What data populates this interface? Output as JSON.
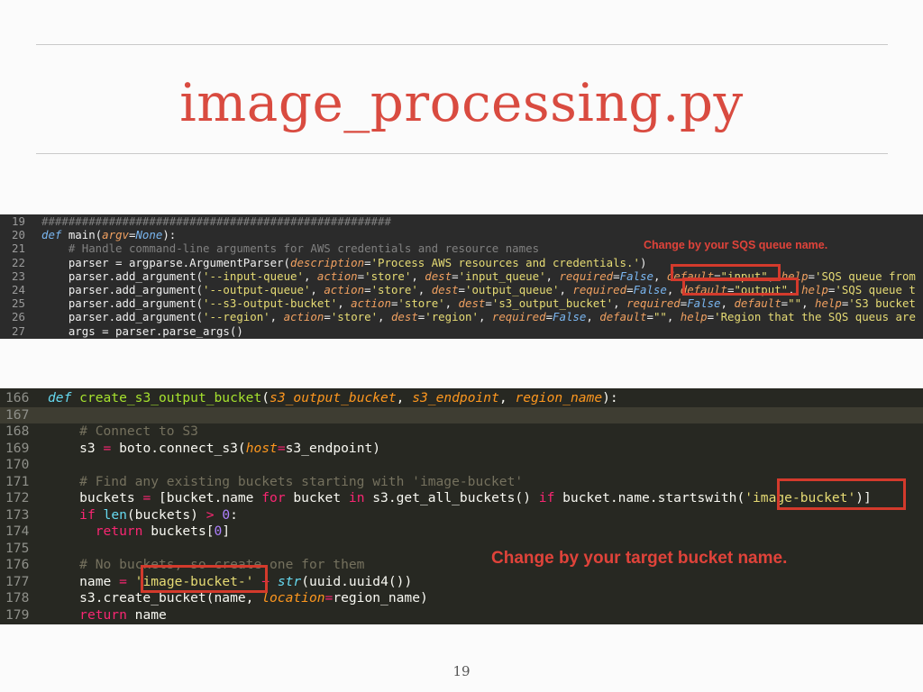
{
  "slide": {
    "title": "image_processing.py",
    "page_number": "19"
  },
  "snippet1": {
    "lines": [
      {
        "n": "19",
        "tokens": [
          {
            "c": "t-cmt1",
            "t": "####################################################"
          }
        ]
      },
      {
        "n": "20",
        "tokens": [
          {
            "c": "t-kw1",
            "t": "def"
          },
          {
            "c": "t-plain1",
            "t": " main("
          },
          {
            "c": "t-arg1",
            "t": "argv"
          },
          {
            "c": "t-plain1",
            "t": "="
          },
          {
            "c": "t-kw1",
            "t": "None"
          },
          {
            "c": "t-plain1",
            "t": "):"
          }
        ]
      },
      {
        "n": "21",
        "tokens": [
          {
            "c": "t-cmt1",
            "t": "    # Handle command-line arguments for AWS credentials and resource names"
          }
        ]
      },
      {
        "n": "22",
        "tokens": [
          {
            "c": "t-plain1",
            "t": "    parser = argparse.ArgumentParser("
          },
          {
            "c": "t-arg1",
            "t": "description"
          },
          {
            "c": "t-plain1",
            "t": "="
          },
          {
            "c": "t-str1",
            "t": "'Process AWS resources and credentials.'"
          },
          {
            "c": "t-plain1",
            "t": ")"
          }
        ]
      },
      {
        "n": "23",
        "tokens": [
          {
            "c": "t-plain1",
            "t": "    parser.add_argument("
          },
          {
            "c": "t-str1",
            "t": "'--input-queue'"
          },
          {
            "c": "t-plain1",
            "t": ", "
          },
          {
            "c": "t-arg1",
            "t": "action"
          },
          {
            "c": "t-plain1",
            "t": "="
          },
          {
            "c": "t-str1",
            "t": "'store'"
          },
          {
            "c": "t-plain1",
            "t": ", "
          },
          {
            "c": "t-arg1",
            "t": "dest"
          },
          {
            "c": "t-plain1",
            "t": "="
          },
          {
            "c": "t-str1",
            "t": "'input_queue'"
          },
          {
            "c": "t-plain1",
            "t": ", "
          },
          {
            "c": "t-arg1",
            "t": "required"
          },
          {
            "c": "t-plain1",
            "t": "="
          },
          {
            "c": "t-kw1",
            "t": "False"
          },
          {
            "c": "t-plain1",
            "t": ", "
          },
          {
            "c": "t-arg1",
            "t": "default"
          },
          {
            "c": "t-plain1",
            "t": "="
          },
          {
            "c": "t-str1",
            "t": "\"input\""
          },
          {
            "c": "t-plain1",
            "t": ", "
          },
          {
            "c": "t-arg1",
            "t": "help"
          },
          {
            "c": "t-plain1",
            "t": "="
          },
          {
            "c": "t-str1",
            "t": "'SQS queue from"
          }
        ]
      },
      {
        "n": "24",
        "tokens": [
          {
            "c": "t-plain1",
            "t": "    parser.add_argument("
          },
          {
            "c": "t-str1",
            "t": "'--output-queue'"
          },
          {
            "c": "t-plain1",
            "t": ", "
          },
          {
            "c": "t-arg1",
            "t": "action"
          },
          {
            "c": "t-plain1",
            "t": "="
          },
          {
            "c": "t-str1",
            "t": "'store'"
          },
          {
            "c": "t-plain1",
            "t": ", "
          },
          {
            "c": "t-arg1",
            "t": "dest"
          },
          {
            "c": "t-plain1",
            "t": "="
          },
          {
            "c": "t-str1",
            "t": "'output_queue'"
          },
          {
            "c": "t-plain1",
            "t": ", "
          },
          {
            "c": "t-arg1",
            "t": "required"
          },
          {
            "c": "t-plain1",
            "t": "="
          },
          {
            "c": "t-kw1",
            "t": "False"
          },
          {
            "c": "t-plain1",
            "t": ", "
          },
          {
            "c": "t-arg1",
            "t": "default"
          },
          {
            "c": "t-plain1",
            "t": "="
          },
          {
            "c": "t-str1",
            "t": "\"output\""
          },
          {
            "c": "t-plain1",
            "t": ", "
          },
          {
            "c": "t-arg1",
            "t": "help"
          },
          {
            "c": "t-plain1",
            "t": "="
          },
          {
            "c": "t-str1",
            "t": "'SQS queue t"
          }
        ]
      },
      {
        "n": "25",
        "tokens": [
          {
            "c": "t-plain1",
            "t": "    parser.add_argument("
          },
          {
            "c": "t-str1",
            "t": "'--s3-output-bucket'"
          },
          {
            "c": "t-plain1",
            "t": ", "
          },
          {
            "c": "t-arg1",
            "t": "action"
          },
          {
            "c": "t-plain1",
            "t": "="
          },
          {
            "c": "t-str1",
            "t": "'store'"
          },
          {
            "c": "t-plain1",
            "t": ", "
          },
          {
            "c": "t-arg1",
            "t": "dest"
          },
          {
            "c": "t-plain1",
            "t": "="
          },
          {
            "c": "t-str1",
            "t": "'s3_output_bucket'"
          },
          {
            "c": "t-plain1",
            "t": ", "
          },
          {
            "c": "t-arg1",
            "t": "required"
          },
          {
            "c": "t-plain1",
            "t": "="
          },
          {
            "c": "t-kw1",
            "t": "False"
          },
          {
            "c": "t-plain1",
            "t": ", "
          },
          {
            "c": "t-arg1",
            "t": "default"
          },
          {
            "c": "t-plain1",
            "t": "="
          },
          {
            "c": "t-str1",
            "t": "\"\""
          },
          {
            "c": "t-plain1",
            "t": ", "
          },
          {
            "c": "t-arg1",
            "t": "help"
          },
          {
            "c": "t-plain1",
            "t": "="
          },
          {
            "c": "t-str1",
            "t": "'S3 bucket"
          }
        ]
      },
      {
        "n": "26",
        "tokens": [
          {
            "c": "t-plain1",
            "t": "    parser.add_argument("
          },
          {
            "c": "t-str1",
            "t": "'--region'"
          },
          {
            "c": "t-plain1",
            "t": ", "
          },
          {
            "c": "t-arg1",
            "t": "action"
          },
          {
            "c": "t-plain1",
            "t": "="
          },
          {
            "c": "t-str1",
            "t": "'store'"
          },
          {
            "c": "t-plain1",
            "t": ", "
          },
          {
            "c": "t-arg1",
            "t": "dest"
          },
          {
            "c": "t-plain1",
            "t": "="
          },
          {
            "c": "t-str1",
            "t": "'region'"
          },
          {
            "c": "t-plain1",
            "t": ", "
          },
          {
            "c": "t-arg1",
            "t": "required"
          },
          {
            "c": "t-plain1",
            "t": "="
          },
          {
            "c": "t-kw1",
            "t": "False"
          },
          {
            "c": "t-plain1",
            "t": ", "
          },
          {
            "c": "t-arg1",
            "t": "default"
          },
          {
            "c": "t-plain1",
            "t": "="
          },
          {
            "c": "t-str1",
            "t": "\"\""
          },
          {
            "c": "t-plain1",
            "t": ", "
          },
          {
            "c": "t-arg1",
            "t": "help"
          },
          {
            "c": "t-plain1",
            "t": "="
          },
          {
            "c": "t-str1",
            "t": "'Region that the SQS queus are"
          }
        ]
      },
      {
        "n": "27",
        "tokens": [
          {
            "c": "t-plain1",
            "t": "    args = parser.parse_args()"
          }
        ]
      }
    ],
    "annotation": "Change by your SQS queue name."
  },
  "snippet2": {
    "lines": [
      {
        "n": "166",
        "tokens": [
          {
            "c": "t-def",
            "t": "def"
          },
          {
            "c": "t-plain",
            "t": " "
          },
          {
            "c": "t-fn",
            "t": "create_s3_output_bucket"
          },
          {
            "c": "t-plain",
            "t": "("
          },
          {
            "c": "t-arg",
            "t": "s3_output_bucket"
          },
          {
            "c": "t-plain",
            "t": ", "
          },
          {
            "c": "t-arg",
            "t": "s3_endpoint"
          },
          {
            "c": "t-plain",
            "t": ", "
          },
          {
            "c": "t-arg",
            "t": "region_name"
          },
          {
            "c": "t-plain",
            "t": "):"
          }
        ]
      },
      {
        "n": "167",
        "cur": true,
        "tokens": [
          {
            "c": "t-plain",
            "t": ""
          }
        ]
      },
      {
        "n": "168",
        "tokens": [
          {
            "c": "t-cmt",
            "t": "    # Connect to S3"
          }
        ]
      },
      {
        "n": "169",
        "tokens": [
          {
            "c": "t-plain",
            "t": "    s3 "
          },
          {
            "c": "t-key",
            "t": "="
          },
          {
            "c": "t-plain",
            "t": " boto.connect_s3("
          },
          {
            "c": "t-arg",
            "t": "host"
          },
          {
            "c": "t-key",
            "t": "="
          },
          {
            "c": "t-plain",
            "t": "s3_endpoint)"
          }
        ]
      },
      {
        "n": "170",
        "tokens": [
          {
            "c": "t-plain",
            "t": ""
          }
        ]
      },
      {
        "n": "171",
        "tokens": [
          {
            "c": "t-cmt",
            "t": "    # Find any existing buckets starting with 'image-bucket'"
          }
        ]
      },
      {
        "n": "172",
        "tokens": [
          {
            "c": "t-plain",
            "t": "    buckets "
          },
          {
            "c": "t-key",
            "t": "="
          },
          {
            "c": "t-plain",
            "t": " [bucket.name "
          },
          {
            "c": "t-key",
            "t": "for"
          },
          {
            "c": "t-plain",
            "t": " bucket "
          },
          {
            "c": "t-key",
            "t": "in"
          },
          {
            "c": "t-plain",
            "t": " s3.get_all_buckets() "
          },
          {
            "c": "t-key",
            "t": "if"
          },
          {
            "c": "t-plain",
            "t": " bucket.name.startswith("
          },
          {
            "c": "t-str",
            "t": "'image-bucket'"
          },
          {
            "c": "t-plain",
            "t": ")]"
          }
        ]
      },
      {
        "n": "173",
        "tokens": [
          {
            "c": "t-plain",
            "t": "    "
          },
          {
            "c": "t-key",
            "t": "if"
          },
          {
            "c": "t-plain",
            "t": " "
          },
          {
            "c": "t-bi",
            "t": "len"
          },
          {
            "c": "t-plain",
            "t": "(buckets) "
          },
          {
            "c": "t-key",
            "t": ">"
          },
          {
            "c": "t-plain",
            "t": " "
          },
          {
            "c": "t-num",
            "t": "0"
          },
          {
            "c": "t-plain",
            "t": ":"
          }
        ]
      },
      {
        "n": "174",
        "tokens": [
          {
            "c": "t-plain",
            "t": "      "
          },
          {
            "c": "t-key",
            "t": "return"
          },
          {
            "c": "t-plain",
            "t": " buckets["
          },
          {
            "c": "t-num",
            "t": "0"
          },
          {
            "c": "t-plain",
            "t": "]"
          }
        ]
      },
      {
        "n": "175",
        "tokens": [
          {
            "c": "t-plain",
            "t": ""
          }
        ]
      },
      {
        "n": "176",
        "tokens": [
          {
            "c": "t-cmt",
            "t": "    # No buckets, so create one for them"
          }
        ]
      },
      {
        "n": "177",
        "tokens": [
          {
            "c": "t-plain",
            "t": "    name "
          },
          {
            "c": "t-key",
            "t": "="
          },
          {
            "c": "t-plain",
            "t": " "
          },
          {
            "c": "t-str",
            "t": "'image-bucket-'"
          },
          {
            "c": "t-plain",
            "t": " "
          },
          {
            "c": "t-key",
            "t": "+"
          },
          {
            "c": "t-plain",
            "t": " "
          },
          {
            "c": "t-def",
            "t": "str"
          },
          {
            "c": "t-plain",
            "t": "(uuid.uuid4())"
          }
        ]
      },
      {
        "n": "178",
        "tokens": [
          {
            "c": "t-plain",
            "t": "    s3.create_bucket(name, "
          },
          {
            "c": "t-arg",
            "t": "location"
          },
          {
            "c": "t-key",
            "t": "="
          },
          {
            "c": "t-plain",
            "t": "region_name)"
          }
        ]
      },
      {
        "n": "179",
        "tokens": [
          {
            "c": "t-plain",
            "t": "    "
          },
          {
            "c": "t-key",
            "t": "return"
          },
          {
            "c": "t-plain",
            "t": " name"
          }
        ]
      }
    ],
    "annotation": "Change by your target bucket name."
  },
  "colors": {
    "title": "#d94b40",
    "highlight_box": "#d33a2c",
    "editor1_bg": "#2b2b2b",
    "editor2_bg": "#272822"
  }
}
